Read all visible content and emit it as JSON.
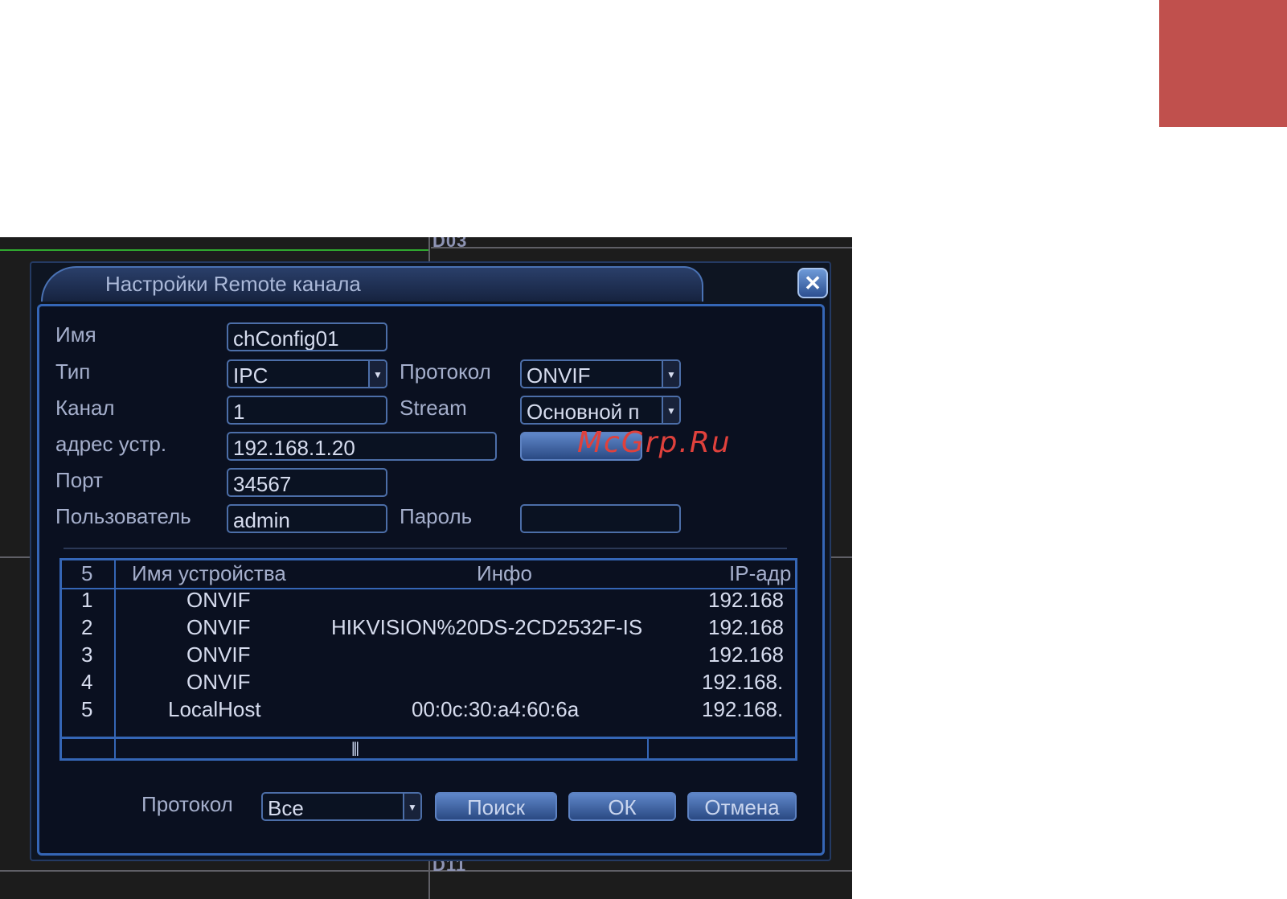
{
  "colors": {
    "accent_block": "#c0504d",
    "dialog_border": "#3566b6",
    "watermark": "#e0413c"
  },
  "background": {
    "channel_top": "D03",
    "channel_bottom": "D11"
  },
  "dialog": {
    "title": "Настройки Remote канала",
    "close_icon": "close-icon",
    "form": {
      "name_label": "Имя",
      "name_value": "chConfig01",
      "type_label": "Тип",
      "type_value": "IPC",
      "protocol_label": "Протокол",
      "protocol_value": "ONVIF",
      "channel_label": "Канал",
      "channel_value": "1",
      "stream_label": "Stream",
      "stream_value": "Основной п",
      "address_label": "адрес устр.",
      "address_value": "192.168.1.20",
      "port_label": "Порт",
      "port_value": "34567",
      "user_label": "Пользователь",
      "user_value": "admin",
      "password_label": "Пароль",
      "password_value": ""
    },
    "table": {
      "headers": [
        "5",
        "Имя устройства",
        "Инфо",
        "IP-адр"
      ],
      "rows": [
        {
          "num": "1",
          "name": "ONVIF",
          "info": "",
          "ip": "192.168"
        },
        {
          "num": "2",
          "name": "ONVIF",
          "info": "HIKVISION%20DS-2CD2532F-IS",
          "ip": "192.168"
        },
        {
          "num": "3",
          "name": "ONVIF",
          "info": "",
          "ip": "192.168"
        },
        {
          "num": "4",
          "name": "ONVIF",
          "info": "",
          "ip": "192.168."
        },
        {
          "num": "5",
          "name": "LocalHost",
          "info": "00:0c:30:a4:60:6a",
          "ip": "192.168."
        }
      ],
      "scroll_grip": "|||"
    },
    "footer": {
      "protocol_label": "Протокол",
      "protocol_value": "Все",
      "search_label": "Поиск",
      "ok_label": "ОК",
      "cancel_label": "Отмена"
    }
  },
  "watermark": "McGrp.Ru"
}
